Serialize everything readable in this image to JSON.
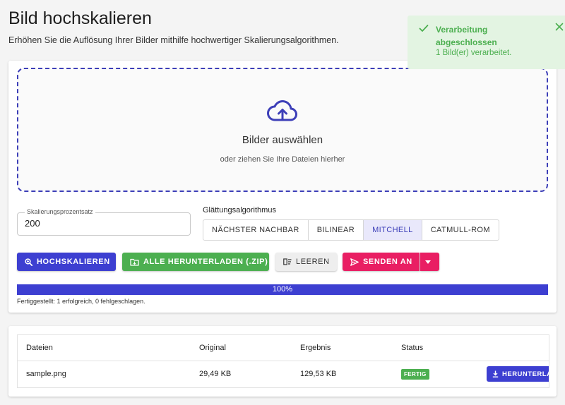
{
  "page": {
    "title": "Bild hochskalieren",
    "subtitle": "Erhöhen Sie die Auflösung Ihrer Bilder mithilfe hochwertiger Skalierungsalgorithmen."
  },
  "dropzone": {
    "icon": "cloud-upload-icon",
    "title": "Bilder auswählen",
    "hint": "oder ziehen Sie Ihre Dateien hierher"
  },
  "scaling": {
    "label": "Skalierungsprozentsatz",
    "value": "200"
  },
  "smoothing": {
    "label": "Glättungsalgorithmus",
    "options": [
      "NÄCHSTER NACHBAR",
      "BILINEAR",
      "MITCHELL",
      "CATMULL-ROM"
    ],
    "selected": "MITCHELL"
  },
  "actions": {
    "upscale": "HOCHSKALIEREN",
    "download_all": "ALLE HERUNTERLADEN (.ZIP)",
    "clear": "LEEREN",
    "send_to": "SENDEN AN"
  },
  "progress": {
    "percent": 100,
    "label": "100%",
    "status": "Fertiggestellt: 1 erfolgreich, 0 fehlgeschlagen."
  },
  "table": {
    "headers": [
      "Dateien",
      "Original",
      "Ergebnis",
      "Status"
    ],
    "rows": [
      {
        "file": "sample.png",
        "original": "29,49 KB",
        "result": "129,53 KB",
        "status": "FERTIG",
        "action": "HERUNTERLADEN"
      }
    ]
  },
  "toast": {
    "title": "Verarbeitung abgeschlossen",
    "message": "1 Bild(er) verarbeitet."
  },
  "colors": {
    "primary": "#3d3fd1",
    "success": "#4caf50",
    "accent": "#e91e63",
    "toast_bg": "#e3f4e2"
  }
}
